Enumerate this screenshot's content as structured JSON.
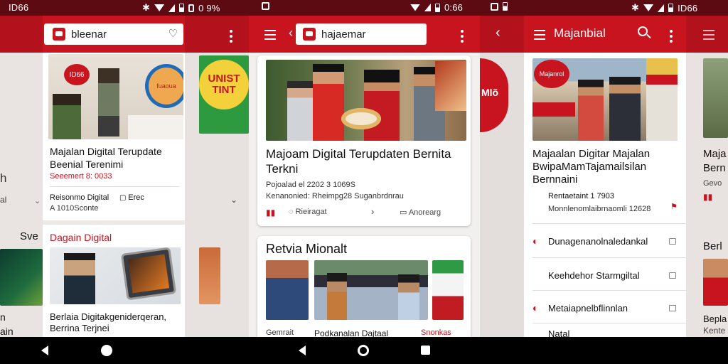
{
  "status_left": {
    "carrier1": "ID66",
    "carrier2": "ID66"
  },
  "status_right": {
    "battery1": "0 9%",
    "time2": "0:66"
  },
  "panel_left": {
    "search_text": "bleenar",
    "logo_badge": "ID66",
    "sign_text": "fuaoua",
    "headline": "Majalan Digital Terupdate Beenial Terenimi",
    "headline_meta": "Seeemert 8: 0033",
    "source_label": "Reisonmo Digital",
    "source_right": "Erec",
    "source_sub": "A 1010Sconte",
    "section_title": "Dagain Digital",
    "story2_title": "Berlaia Digitakgeniderqeran, Berrina Terjnei",
    "bg_headline_frag": "h",
    "bg_label": "al",
    "bg_section": "Sve",
    "bg_bottom1": "n",
    "bg_bottom2": "ain"
  },
  "panel_mid": {
    "search_text": "hajaemar",
    "headline": "Majoam Digital Terupdaten Bernita Terkni",
    "date_line": "Pojoalad el 2202 3 1069S",
    "meta_line": "Kenanonied: Rheimpg28 Suganbrdnrau",
    "action_like": "",
    "action_share": "Rieiragat",
    "action_arrow": "›",
    "action_comment": "Anorearg",
    "section_title": "Retvia Mionalt",
    "cap1": "Gemrait",
    "cap2": "Podkanalan Dajtaal",
    "cap3": "Snonkas",
    "bg_banner": "UNIST TINT",
    "bg_right": "Mlõ"
  },
  "panel_right": {
    "title": "Majanbial",
    "logo_text": "Majanrol",
    "headline": "Majaalan Digitar Majalan BwipaMamTajamailsilan Bernnaini",
    "time_line": "Rentaetaint 1 7903",
    "source_line": "Monnlenomlaibrnaomli 12628",
    "rows": [
      "Dunagenanolnaledankal",
      "Keehdehor Starmgiltal",
      "Metaiapnelbflinnlan",
      "Natal"
    ],
    "bg_frag1": "Maja",
    "bg_frag2": "Bern",
    "bg_frag3": "Gevo",
    "bg_frag4": "Berl",
    "bg_frag5": "Bepla",
    "bg_frag6": "Kente"
  },
  "colors": {
    "accent": "#c8141f",
    "appbar_dark": "#5c0b12"
  }
}
